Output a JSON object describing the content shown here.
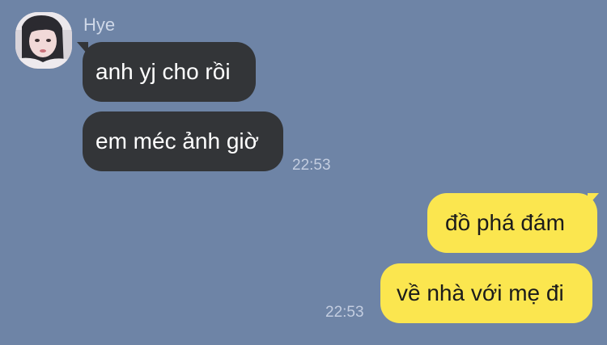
{
  "conversation": {
    "contact": {
      "name": "Hye",
      "avatar_icon": "profile-photo-avatar"
    },
    "incoming": {
      "messages": [
        "anh yj cho rồi",
        "em méc ảnh giờ"
      ],
      "timestamp": "22:53"
    },
    "outgoing": {
      "messages": [
        "đồ phá đám",
        "về nhà với mẹ đi"
      ],
      "timestamp": "22:53"
    }
  },
  "theme": {
    "background": "#6e84a6",
    "incoming_bubble": "#333538",
    "outgoing_bubble": "#fbe64f"
  }
}
